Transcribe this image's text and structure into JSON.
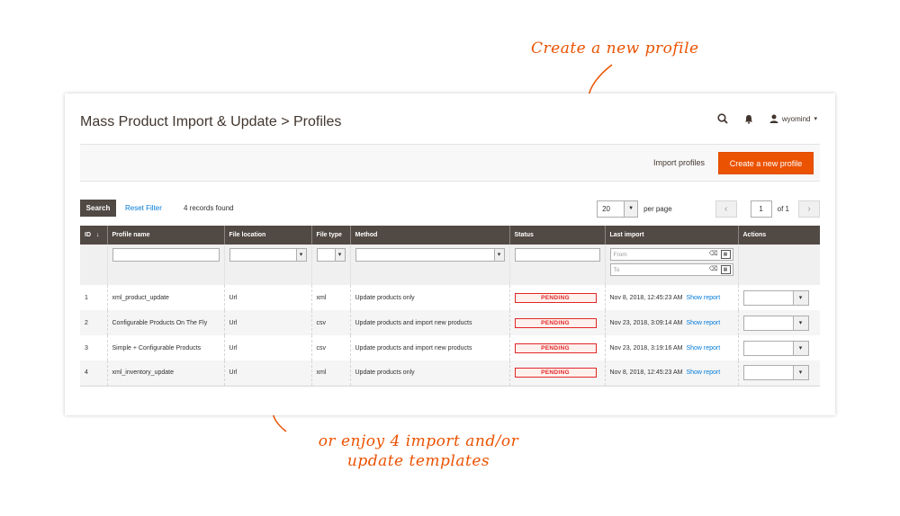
{
  "annotations": {
    "top": "Create a new profile",
    "bottom_line1": "or enjoy 4 import and/or",
    "bottom_line2": "update templates"
  },
  "header": {
    "title": "Mass Product Import & Update > Profiles",
    "user": "wyomind"
  },
  "action_bar": {
    "import_label": "Import profiles",
    "create_label": "Create a new profile"
  },
  "grid_toolbar": {
    "search_label": "Search",
    "reset_label": "Reset Filter",
    "records": "4 records found",
    "per_page_value": "20",
    "per_page_label": "per page",
    "page": "1",
    "of_pages": "of 1"
  },
  "columns": [
    "ID",
    "Profile name",
    "File location",
    "File type",
    "Method",
    "Status",
    "Last import",
    "Actions"
  ],
  "filters": {
    "date_from": "From",
    "date_to": "To"
  },
  "rows": [
    {
      "id": "1",
      "name": "xml_product_update",
      "location": "Url",
      "type": "xml",
      "method": "Update products only",
      "status": "PENDING",
      "last_import": "Nov 8, 2018, 12:45:23 AM",
      "report": "Show report"
    },
    {
      "id": "2",
      "name": "Configurable Products On The Fly",
      "location": "Url",
      "type": "csv",
      "method": "Update products and import new products",
      "status": "PENDING",
      "last_import": "Nov 23, 2018, 3:09:14 AM",
      "report": "Show report"
    },
    {
      "id": "3",
      "name": "Simple + Configurable Products",
      "location": "Url",
      "type": "csv",
      "method": "Update products and import new products",
      "status": "PENDING",
      "last_import": "Nov 23, 2018, 3:19:16 AM",
      "report": "Show report"
    },
    {
      "id": "4",
      "name": "xml_inventory_update",
      "location": "Url",
      "type": "xml",
      "method": "Update products only",
      "status": "PENDING",
      "last_import": "Nov 8, 2018, 12:45:23 AM",
      "report": "Show report"
    }
  ],
  "colors": {
    "accent": "#eb5202",
    "header_bg": "#514943",
    "link": "#007bdb",
    "pending": "#e22626"
  },
  "icons": [
    "search-icon",
    "bell-icon",
    "user-icon",
    "chevron-down-icon",
    "calendar-icon",
    "sort-arrow-icon"
  ]
}
